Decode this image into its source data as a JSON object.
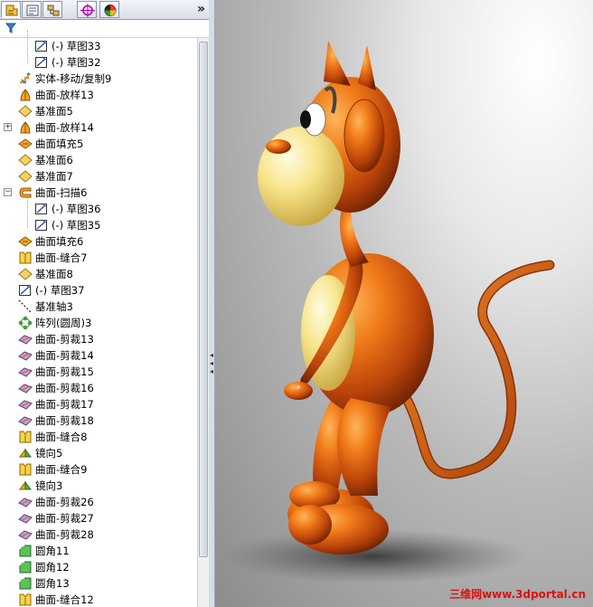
{
  "tabs": [
    {
      "name": "feature-manager",
      "icon": "feature-tree-icon"
    },
    {
      "name": "property-manager",
      "icon": "property-icon"
    },
    {
      "name": "configuration-manager",
      "icon": "configuration-icon"
    },
    {
      "name": "dimxpert",
      "icon": "crosshair-icon"
    },
    {
      "name": "display-manager",
      "icon": "appearance-icon"
    }
  ],
  "expand_label": "»",
  "tree": [
    {
      "label": "(-) 草图33",
      "icon": "sketch-icon",
      "indent": 2
    },
    {
      "label": "(-) 草图32",
      "icon": "sketch-icon",
      "indent": 2
    },
    {
      "label": "实体-移动/复制9",
      "icon": "move-copy-icon",
      "indent": 1
    },
    {
      "label": "曲面-放样13",
      "icon": "surface-loft-icon",
      "indent": 1
    },
    {
      "label": "基准面5",
      "icon": "plane-icon",
      "indent": 1
    },
    {
      "label": "曲面-放样14",
      "icon": "surface-loft-icon",
      "indent": 1,
      "expander": "+"
    },
    {
      "label": "曲面填充5",
      "icon": "surface-fill-icon",
      "indent": 1
    },
    {
      "label": "基准面6",
      "icon": "plane-icon",
      "indent": 1
    },
    {
      "label": "基准面7",
      "icon": "plane-icon",
      "indent": 1
    },
    {
      "label": "曲面-扫描6",
      "icon": "surface-sweep-icon",
      "indent": 1,
      "expander": "−"
    },
    {
      "label": "(-) 草图36",
      "icon": "sketch-icon",
      "indent": 2
    },
    {
      "label": "(-) 草图35",
      "icon": "sketch-icon",
      "indent": 2
    },
    {
      "label": "曲面填充6",
      "icon": "surface-fill-icon",
      "indent": 1
    },
    {
      "label": "曲面-缝合7",
      "icon": "surface-knit-icon",
      "indent": 1
    },
    {
      "label": "基准面8",
      "icon": "plane-icon",
      "indent": 1
    },
    {
      "label": "(-) 草图37",
      "icon": "sketch-icon",
      "indent": 1
    },
    {
      "label": "基准轴3",
      "icon": "axis-icon",
      "indent": 1
    },
    {
      "label": "阵列(圆周)3",
      "icon": "circular-pattern-icon",
      "indent": 1
    },
    {
      "label": "曲面-剪裁13",
      "icon": "surface-trim-icon",
      "indent": 1
    },
    {
      "label": "曲面-剪裁14",
      "icon": "surface-trim-icon",
      "indent": 1
    },
    {
      "label": "曲面-剪裁15",
      "icon": "surface-trim-icon",
      "indent": 1
    },
    {
      "label": "曲面-剪裁16",
      "icon": "surface-trim-icon",
      "indent": 1
    },
    {
      "label": "曲面-剪裁17",
      "icon": "surface-trim-icon",
      "indent": 1
    },
    {
      "label": "曲面-剪裁18",
      "icon": "surface-trim-icon",
      "indent": 1
    },
    {
      "label": "曲面-缝合8",
      "icon": "surface-knit-icon",
      "indent": 1
    },
    {
      "label": "镜向5",
      "icon": "mirror-icon",
      "indent": 1
    },
    {
      "label": "曲面-缝合9",
      "icon": "surface-knit-icon",
      "indent": 1
    },
    {
      "label": "镜向3",
      "icon": "mirror-icon",
      "indent": 1
    },
    {
      "label": "曲面-剪裁26",
      "icon": "surface-trim-icon",
      "indent": 1
    },
    {
      "label": "曲面-剪裁27",
      "icon": "surface-trim-icon",
      "indent": 1
    },
    {
      "label": "曲面-剪裁28",
      "icon": "surface-trim-icon",
      "indent": 1
    },
    {
      "label": "圆角11",
      "icon": "fillet-icon",
      "indent": 1
    },
    {
      "label": "圆角12",
      "icon": "fillet-icon",
      "indent": 1
    },
    {
      "label": "圆角13",
      "icon": "fillet-icon",
      "indent": 1
    },
    {
      "label": "曲面-缝合12",
      "icon": "surface-knit-icon",
      "indent": 1
    }
  ],
  "viewport": {
    "subject": "monkey-model-3d",
    "watermark": "三维网www.3dportal.cn"
  },
  "colors": {
    "model_orange": "#e0660e",
    "model_cream": "#f4e07a",
    "watermark_red": "#dd1111"
  }
}
